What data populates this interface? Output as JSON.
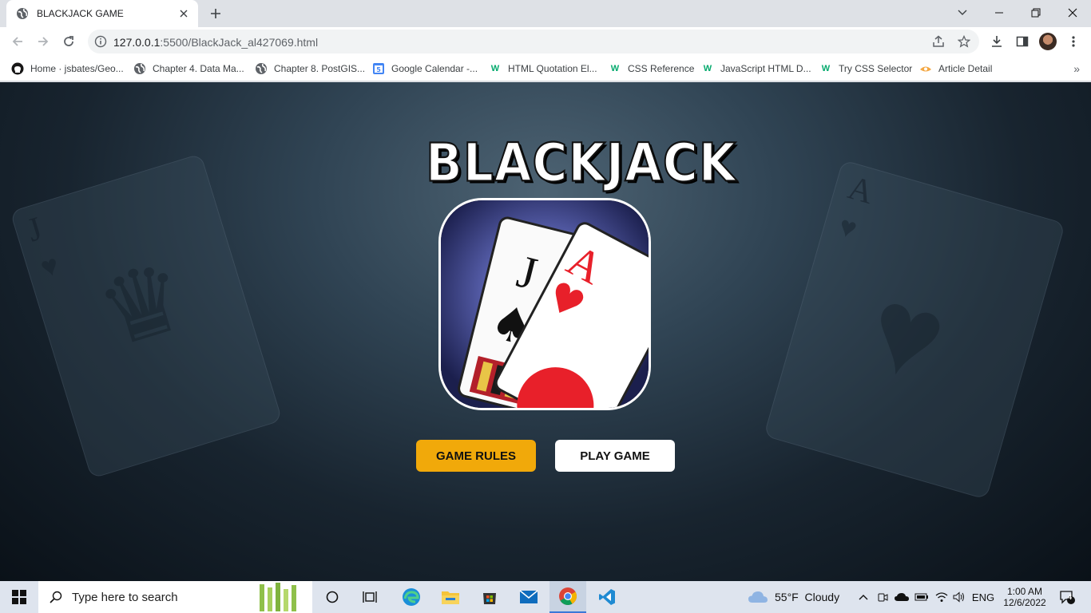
{
  "browser": {
    "tab_title": "BLACKJACK GAME",
    "url_host": "127.0.0.1",
    "url_rest": ":5500/BlackJack_al427069.html"
  },
  "bookmarks": [
    {
      "label": "Home · jsbates/Geo...",
      "icon": "github-icon"
    },
    {
      "label": "Chapter 4. Data Ma...",
      "icon": "globe-icon"
    },
    {
      "label": "Chapter 8. PostGIS...",
      "icon": "globe-icon"
    },
    {
      "label": "Google Calendar -...",
      "icon": "calendar-icon"
    },
    {
      "label": "HTML Quotation El...",
      "icon": "w3schools-icon"
    },
    {
      "label": "CSS Reference",
      "icon": "w3schools-icon"
    },
    {
      "label": "JavaScript HTML D...",
      "icon": "w3schools-icon"
    },
    {
      "label": "Try CSS Selector",
      "icon": "w3schools-icon"
    },
    {
      "label": "Article Detail",
      "icon": "article-icon"
    }
  ],
  "page": {
    "logo_text": "BLACKJACK",
    "rules_button": "GAME RULES",
    "play_button": "PLAY GAME",
    "card_jack_rank": "J",
    "card_ace_rank": "A",
    "bg_card_left_rank": "J",
    "bg_card_right_rank": "A"
  },
  "taskbar": {
    "search_placeholder": "Type here to search",
    "weather": "55°F  Cloudy",
    "language": "ENG",
    "time": "1:00 AM",
    "date": "12/6/2022",
    "notification_count": "4"
  },
  "colors": {
    "rules_button_bg": "#f1a90a",
    "play_button_bg": "#ffffff",
    "card_red": "#e8202a"
  }
}
